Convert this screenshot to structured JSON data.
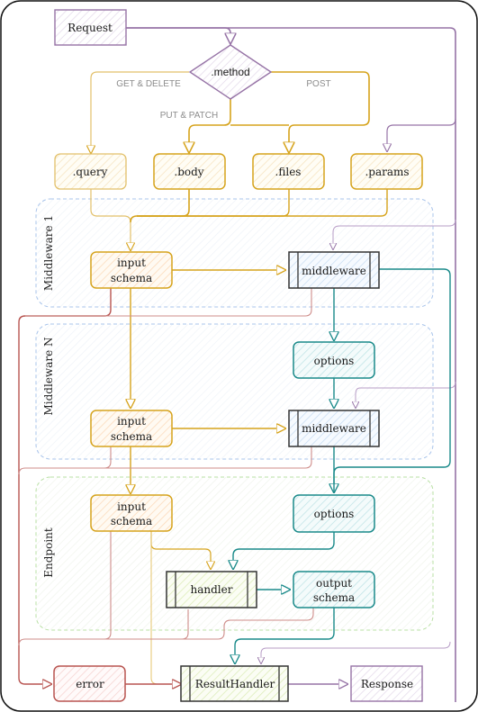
{
  "colors": {
    "purple": "#9673a6",
    "yellow": "#d6a31c",
    "yellow_light": "#e6c36a",
    "teal": "#1a8a8a",
    "red": "#b85450",
    "dark": "#333333",
    "blue_dash": "#a9c4eb",
    "green_dash": "#b9e0a5"
  },
  "nodes": {
    "request": "Request",
    "method": ".method",
    "query": ".query",
    "body": ".body",
    "files": ".files",
    "params": ".params",
    "input_schema_1": [
      "input",
      "schema"
    ],
    "middleware_1": "middleware",
    "options_n": "options",
    "input_schema_n": [
      "input",
      "schema"
    ],
    "middleware_n": "middleware",
    "input_schema_ep": [
      "input",
      "schema"
    ],
    "options_ep": "options",
    "handler": "handler",
    "output_schema": [
      "output",
      "schema"
    ],
    "error": "error",
    "result_handler": "ResultHandler",
    "response": "Response"
  },
  "edge_labels": {
    "get_delete": "GET & DELETE",
    "put_patch": "PUT & PATCH",
    "post": "POST"
  },
  "groups": {
    "middleware_1": "Middleware 1",
    "middleware_n": "Middleware N",
    "endpoint": "Endpoint"
  }
}
